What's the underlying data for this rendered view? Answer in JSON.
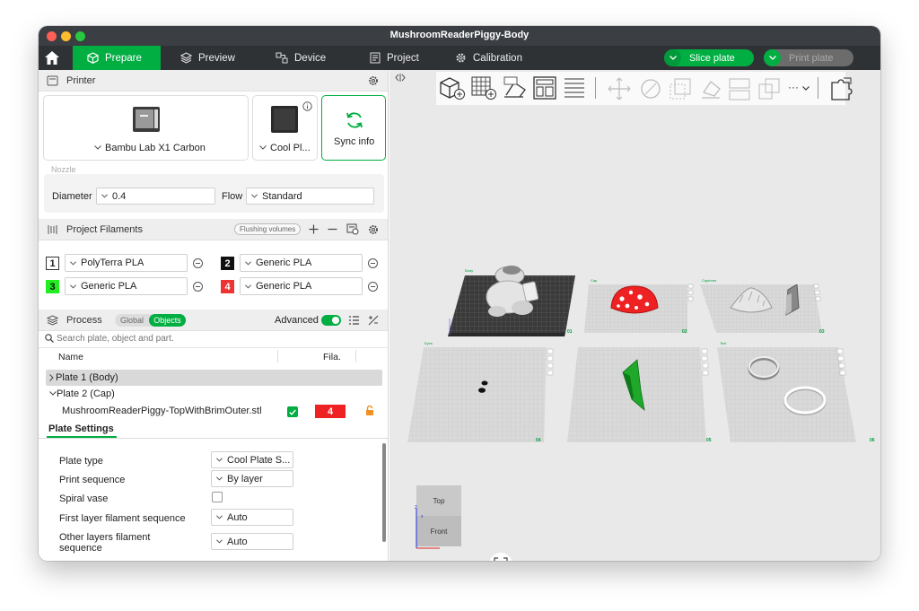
{
  "window": {
    "title": "MushroomReaderPiggy-Body"
  },
  "toolbar": {
    "tabs": [
      "Prepare",
      "Preview",
      "Device",
      "Project",
      "Calibration"
    ],
    "slice_label": "Slice plate",
    "print_label": "Print plate"
  },
  "printer": {
    "section_title": "Printer",
    "model": "Bambu Lab X1 Carbon",
    "plate": "Cool Pl...",
    "sync_label": "Sync info",
    "nozzle_label": "Nozzle",
    "diameter_label": "Diameter",
    "diameter_value": "0.4",
    "flow_label": "Flow",
    "flow_value": "Standard"
  },
  "filaments": {
    "section_title": "Project Filaments",
    "flushing_label": "Flushing volumes",
    "items": [
      {
        "num": "1",
        "name": "PolyTerra PLA",
        "color": "#ffffff"
      },
      {
        "num": "2",
        "name": "Generic PLA",
        "color": "#111111"
      },
      {
        "num": "3",
        "name": "Generic PLA",
        "color": "#22ee22"
      },
      {
        "num": "4",
        "name": "Generic PLA",
        "color": "#ee3333"
      }
    ]
  },
  "process": {
    "section_title": "Process",
    "global_label": "Global",
    "objects_label": "Objects",
    "advanced_label": "Advanced",
    "search_placeholder": "Search plate, object and part.",
    "col_name": "Name",
    "col_fila": "Fila.",
    "plate1": "Plate 1 (Body)",
    "plate2": "Plate 2 (Cap)",
    "object_name": "MushroomReaderPiggy-TopWithBrimOuter.stl",
    "object_fila": "4"
  },
  "plate_settings": {
    "tab_label": "Plate Settings",
    "rows": [
      {
        "label": "Plate type",
        "value": "Cool Plate S..."
      },
      {
        "label": "Print sequence",
        "value": "By layer"
      },
      {
        "label": "Spiral vase",
        "value": ""
      },
      {
        "label": "First layer filament sequence",
        "value": "Auto"
      },
      {
        "label": "Other layers filament",
        "label2": "sequence",
        "value": "Auto"
      }
    ]
  },
  "viewport": {
    "cube_top": "Top",
    "cube_front": "Front",
    "more_label": "···",
    "plates": [
      {
        "name": "Body",
        "num": "01"
      },
      {
        "name": "Cap",
        "num": "02"
      },
      {
        "name": "Capinner",
        "num": "03"
      },
      {
        "name": "Eyes",
        "num": "04"
      },
      {
        "name": "",
        "num": "05"
      },
      {
        "name": "Text",
        "num": "06"
      }
    ]
  },
  "colors": {
    "accent": "#00ae42",
    "titlebar": "#3b3f43",
    "toolbar": "#2f3235",
    "cap_red": "#ee2222"
  }
}
